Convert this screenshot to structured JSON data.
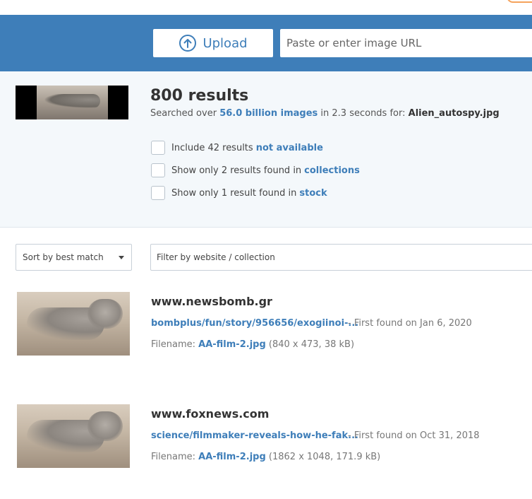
{
  "header": {
    "upload_label": "Upload",
    "url_placeholder": "Paste or enter image URL"
  },
  "summary": {
    "result_count": "800 results",
    "searched_prefix": "Searched over",
    "searched_link": "56.0 billion images",
    "searched_mid": "in 2.3 seconds for:",
    "searched_file": "Alien_autospy.jpg",
    "filters": [
      {
        "text": "Include 42 results",
        "link": "not available"
      },
      {
        "text": "Show only 2 results found in",
        "link": "collections"
      },
      {
        "text": "Show only 1 result found in",
        "link": "stock"
      }
    ]
  },
  "controls": {
    "sort_value": "Sort by best match",
    "filter_placeholder": "Filter by website / collection"
  },
  "results": [
    {
      "site": "www.newsbomb.gr",
      "link": "bombplus/fun/story/956656/exogiinoi-...",
      "found": "- First found on Jan 6, 2020",
      "filename_label": "Filename:",
      "filename": "AA-film-2.jpg",
      "meta": "(840 x 473, 38 kB)"
    },
    {
      "site": "www.foxnews.com",
      "link": "science/filmmaker-reveals-how-he-fak...",
      "found": "- First found on Oct 31, 2018",
      "filename_label": "Filename:",
      "filename": "AA-film-2.jpg",
      "meta": "(1862 x 1048, 171.9 kB)"
    }
  ],
  "colors": {
    "brand_blue": "#3e7eb9",
    "accent_orange": "#f5a35c",
    "summary_bg": "#f4f8fb"
  },
  "icons": {
    "upload": "upload-arrow-circle-icon",
    "dropdown": "chevron-down-icon"
  }
}
